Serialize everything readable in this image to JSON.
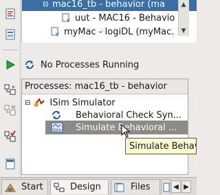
{
  "hierarchy": {
    "rows": [
      {
        "label": "mac16_tb - behavior (ma",
        "selected": true
      },
      {
        "label": "uut - MAC16 - Behavio"
      },
      {
        "label": "myMac - logiDL (myMac."
      }
    ]
  },
  "processes": {
    "status": "No Processes Running",
    "header": "Processes: mac16_tb - behavior",
    "items": [
      {
        "label": "ISim Simulator"
      },
      {
        "label": "Behavioral Check Syn..."
      },
      {
        "label": "Simulate Behavioral ...",
        "highlighted": true
      }
    ],
    "sim_icon_text": "ISim"
  },
  "tooltip": {
    "text": "Simulate Behav"
  },
  "tabs": [
    {
      "label": "Start"
    },
    {
      "label": "Design",
      "active": true
    },
    {
      "label": "Files"
    }
  ],
  "colors": {
    "selection": "#3c6ea6",
    "highlight_row": "#8c8a84",
    "tooltip_bg": "#fbf9d0"
  }
}
